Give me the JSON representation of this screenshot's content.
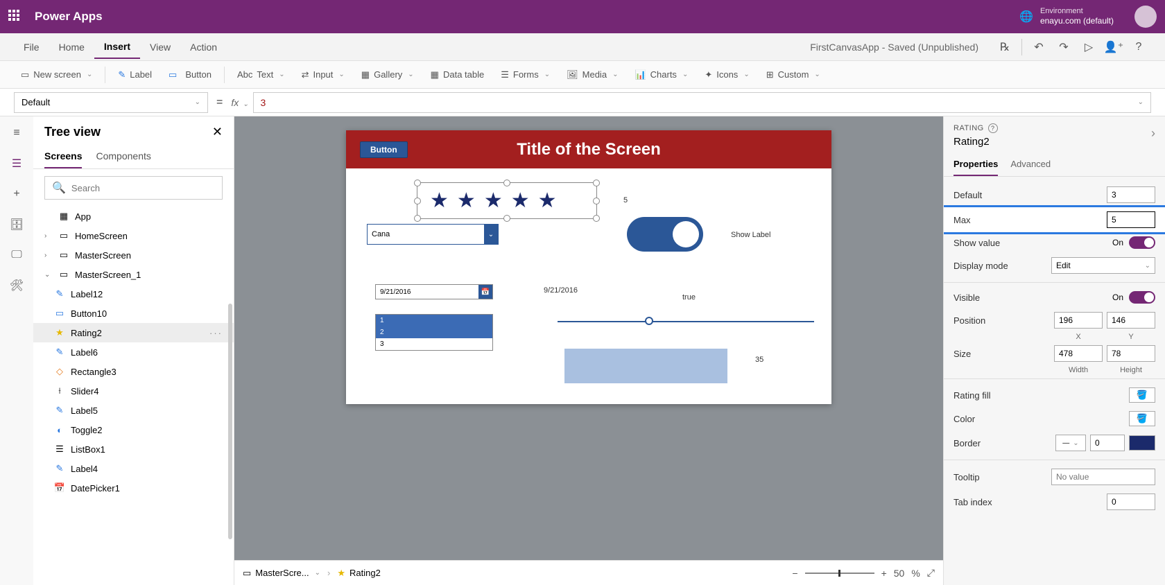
{
  "header": {
    "app_name": "Power Apps",
    "env_label": "Environment",
    "env_name": "enayu.com (default)"
  },
  "menu": {
    "items": [
      "File",
      "Home",
      "Insert",
      "View",
      "Action"
    ],
    "active": "Insert",
    "doc_title": "FirstCanvasApp - Saved (Unpublished)"
  },
  "ribbon": {
    "new_screen": "New screen",
    "label": "Label",
    "button": "Button",
    "text": "Text",
    "input": "Input",
    "gallery": "Gallery",
    "data_table": "Data table",
    "forms": "Forms",
    "media": "Media",
    "charts": "Charts",
    "icons": "Icons",
    "custom": "Custom"
  },
  "formula": {
    "property": "Default",
    "value": "3"
  },
  "tree": {
    "title": "Tree view",
    "tabs": {
      "screens": "Screens",
      "components": "Components"
    },
    "search_placeholder": "Search",
    "nodes": {
      "app": "App",
      "home": "HomeScreen",
      "master": "MasterScreen",
      "master1": "MasterScreen_1",
      "label12": "Label12",
      "button10": "Button10",
      "rating2": "Rating2",
      "label6": "Label6",
      "rectangle3": "Rectangle3",
      "slider4": "Slider4",
      "label5": "Label5",
      "toggle2": "Toggle2",
      "listbox1": "ListBox1",
      "label4": "Label4",
      "datepicker1": "DatePicker1"
    }
  },
  "canvas": {
    "button_text": "Button",
    "screen_title": "Title of the Screen",
    "rating_value_label": "5",
    "dropdown_value": "Cana",
    "show_label": "Show Label",
    "date_value": "9/21/2016",
    "date_label": "9/21/2016",
    "true_label": "true",
    "slider_label": "35",
    "listbox": [
      "1",
      "2",
      "3"
    ]
  },
  "breadcrumb": {
    "screen": "MasterScre...",
    "control": "Rating2"
  },
  "zoom": {
    "value": "50",
    "pct": "%"
  },
  "props": {
    "type_label": "RATING",
    "name": "Rating2",
    "tabs": {
      "properties": "Properties",
      "advanced": "Advanced"
    },
    "default_label": "Default",
    "default_value": "3",
    "max_label": "Max",
    "max_value": "5",
    "show_value_label": "Show value",
    "show_value_state": "On",
    "display_mode_label": "Display mode",
    "display_mode_value": "Edit",
    "visible_label": "Visible",
    "visible_state": "On",
    "position_label": "Position",
    "pos_x": "196",
    "pos_y": "146",
    "x_label": "X",
    "y_label": "Y",
    "size_label": "Size",
    "width": "478",
    "height": "78",
    "w_label": "Width",
    "h_label": "Height",
    "rating_fill_label": "Rating fill",
    "color_label": "Color",
    "border_label": "Border",
    "border_value": "0",
    "tooltip_label": "Tooltip",
    "tooltip_placeholder": "No value",
    "tabindex_label": "Tab index",
    "tabindex_value": "0"
  }
}
